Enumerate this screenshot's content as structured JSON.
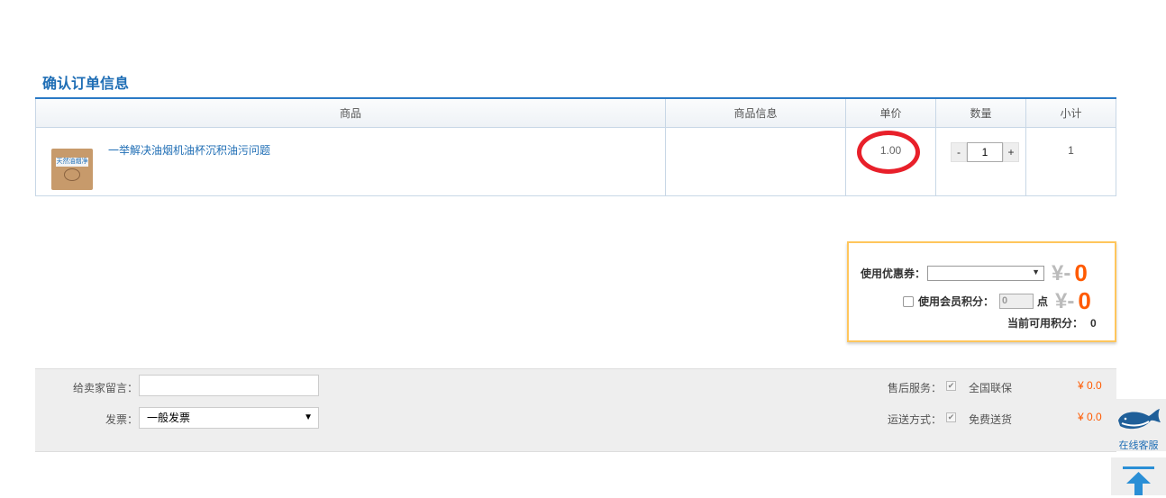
{
  "page_title": "确认订单信息",
  "table": {
    "headers": [
      "商品",
      "商品信息",
      "单价",
      "数量",
      "小计"
    ],
    "rows": [
      {
        "thumb_text": "天然油烟净",
        "name": "一举解决油烟机油杯沉积油污问题",
        "info": "",
        "price": "1.00",
        "qty": "1",
        "qty_minus": "-",
        "qty_plus": "+",
        "subtotal": "1"
      }
    ]
  },
  "discount": {
    "coupon_label": "使用优惠券：",
    "coupon_value": "",
    "yen_prefix": "¥-",
    "coupon_amount": "0",
    "points_label": "使用会员积分：",
    "points_value": "0",
    "points_unit": "点",
    "points_amount": "0",
    "available_label": "当前可用积分：",
    "available_value": "0"
  },
  "order_options": {
    "message_label": "给卖家留言：",
    "message_value": "",
    "invoice_label": "发票：",
    "invoice_value": "一般发票",
    "after_sales_label": "售后服务：",
    "after_sales_value": "全国联保",
    "after_sales_fee": "¥ 0.0",
    "shipping_label": "运送方式：",
    "shipping_value": "免费送货",
    "shipping_fee": "¥ 0.0"
  },
  "widgets": {
    "customer_service": "在线客服"
  },
  "colors": {
    "accent": "#1f6eb5",
    "price_orange": "#ff5a00",
    "highlight_ring": "#e8202a",
    "box_border": "#ffc65c"
  }
}
